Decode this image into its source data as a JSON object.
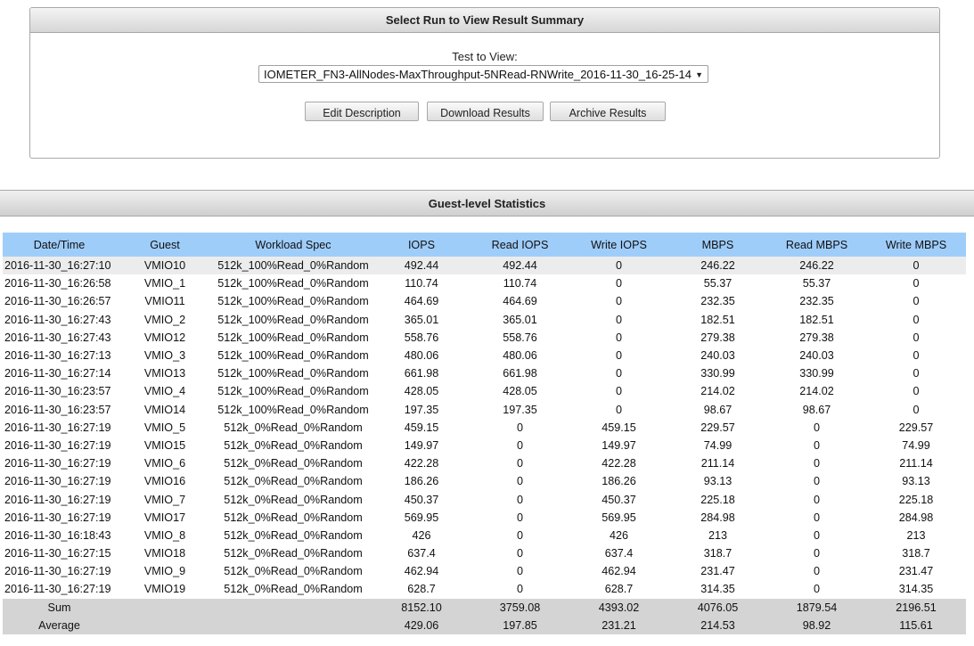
{
  "run_panel": {
    "title": "Select Run to View Result Summary",
    "test_label": "Test to View:",
    "selected_test": "IOMETER_FN3-AllNodes-MaxThroughput-5NRead-RNWrite_2016-11-30_16-25-14",
    "buttons": {
      "edit": "Edit Description",
      "download": "Download Results",
      "archive": "Archive Results"
    }
  },
  "stats": {
    "title": "Guest-level Statistics",
    "columns": [
      "Date/Time",
      "Guest",
      "Workload Spec",
      "IOPS",
      "Read IOPS",
      "Write IOPS",
      "MBPS",
      "Read MBPS",
      "Write MBPS"
    ],
    "rows": [
      [
        "2016-11-30_16:27:10",
        "VMIO10",
        "512k_100%Read_0%Random",
        "492.44",
        "492.44",
        "0",
        "246.22",
        "246.22",
        "0"
      ],
      [
        "2016-11-30_16:26:58",
        "VMIO_1",
        "512k_100%Read_0%Random",
        "110.74",
        "110.74",
        "0",
        "55.37",
        "55.37",
        "0"
      ],
      [
        "2016-11-30_16:26:57",
        "VMIO11",
        "512k_100%Read_0%Random",
        "464.69",
        "464.69",
        "0",
        "232.35",
        "232.35",
        "0"
      ],
      [
        "2016-11-30_16:27:43",
        "VMIO_2",
        "512k_100%Read_0%Random",
        "365.01",
        "365.01",
        "0",
        "182.51",
        "182.51",
        "0"
      ],
      [
        "2016-11-30_16:27:43",
        "VMIO12",
        "512k_100%Read_0%Random",
        "558.76",
        "558.76",
        "0",
        "279.38",
        "279.38",
        "0"
      ],
      [
        "2016-11-30_16:27:13",
        "VMIO_3",
        "512k_100%Read_0%Random",
        "480.06",
        "480.06",
        "0",
        "240.03",
        "240.03",
        "0"
      ],
      [
        "2016-11-30_16:27:14",
        "VMIO13",
        "512k_100%Read_0%Random",
        "661.98",
        "661.98",
        "0",
        "330.99",
        "330.99",
        "0"
      ],
      [
        "2016-11-30_16:23:57",
        "VMIO_4",
        "512k_100%Read_0%Random",
        "428.05",
        "428.05",
        "0",
        "214.02",
        "214.02",
        "0"
      ],
      [
        "2016-11-30_16:23:57",
        "VMIO14",
        "512k_100%Read_0%Random",
        "197.35",
        "197.35",
        "0",
        "98.67",
        "98.67",
        "0"
      ],
      [
        "2016-11-30_16:27:19",
        "VMIO_5",
        "512k_0%Read_0%Random",
        "459.15",
        "0",
        "459.15",
        "229.57",
        "0",
        "229.57"
      ],
      [
        "2016-11-30_16:27:19",
        "VMIO15",
        "512k_0%Read_0%Random",
        "149.97",
        "0",
        "149.97",
        "74.99",
        "0",
        "74.99"
      ],
      [
        "2016-11-30_16:27:19",
        "VMIO_6",
        "512k_0%Read_0%Random",
        "422.28",
        "0",
        "422.28",
        "211.14",
        "0",
        "211.14"
      ],
      [
        "2016-11-30_16:27:19",
        "VMIO16",
        "512k_0%Read_0%Random",
        "186.26",
        "0",
        "186.26",
        "93.13",
        "0",
        "93.13"
      ],
      [
        "2016-11-30_16:27:19",
        "VMIO_7",
        "512k_0%Read_0%Random",
        "450.37",
        "0",
        "450.37",
        "225.18",
        "0",
        "225.18"
      ],
      [
        "2016-11-30_16:27:19",
        "VMIO17",
        "512k_0%Read_0%Random",
        "569.95",
        "0",
        "569.95",
        "284.98",
        "0",
        "284.98"
      ],
      [
        "2016-11-30_16:18:43",
        "VMIO_8",
        "512k_0%Read_0%Random",
        "426",
        "0",
        "426",
        "213",
        "0",
        "213"
      ],
      [
        "2016-11-30_16:27:15",
        "VMIO18",
        "512k_0%Read_0%Random",
        "637.4",
        "0",
        "637.4",
        "318.7",
        "0",
        "318.7"
      ],
      [
        "2016-11-30_16:27:19",
        "VMIO_9",
        "512k_0%Read_0%Random",
        "462.94",
        "0",
        "462.94",
        "231.47",
        "0",
        "231.47"
      ],
      [
        "2016-11-30_16:27:19",
        "VMIO19",
        "512k_0%Read_0%Random",
        "628.7",
        "0",
        "628.7",
        "314.35",
        "0",
        "314.35"
      ]
    ],
    "sum": {
      "label": "Sum",
      "values": [
        "8152.10",
        "3759.08",
        "4393.02",
        "4076.05",
        "1879.54",
        "2196.51"
      ]
    },
    "average": {
      "label": "Average",
      "values": [
        "429.06",
        "197.85",
        "231.21",
        "214.53",
        "98.92",
        "115.61"
      ]
    }
  }
}
